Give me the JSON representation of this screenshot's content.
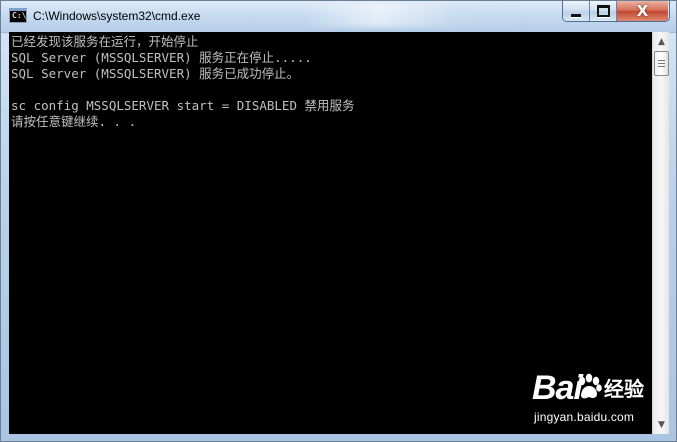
{
  "window": {
    "title": "C:\\Windows\\system32\\cmd.exe",
    "icon": "cmd-icon",
    "buttons": {
      "minimize": "minimize-icon",
      "maximize": "maximize-icon",
      "close": "close-icon",
      "close_label": "X"
    }
  },
  "console": {
    "lines": [
      "已经发现该服务在运行，开始停止",
      "SQL Server (MSSQLSERVER) 服务正在停止.....",
      "SQL Server (MSSQLSERVER) 服务已成功停止。",
      "",
      "sc config MSSQLSERVER start = DISABLED 禁用服务",
      "请按任意键继续. . ."
    ],
    "background": "#000000",
    "text_color": "#c0c0c0"
  },
  "scrollbar": {
    "up_icon": "scroll-up-icon",
    "down_icon": "scroll-down-icon"
  },
  "watermark": {
    "logo_text_bai": "Bai",
    "logo_text_du": "经验",
    "site": "jingyan.baidu.com"
  }
}
